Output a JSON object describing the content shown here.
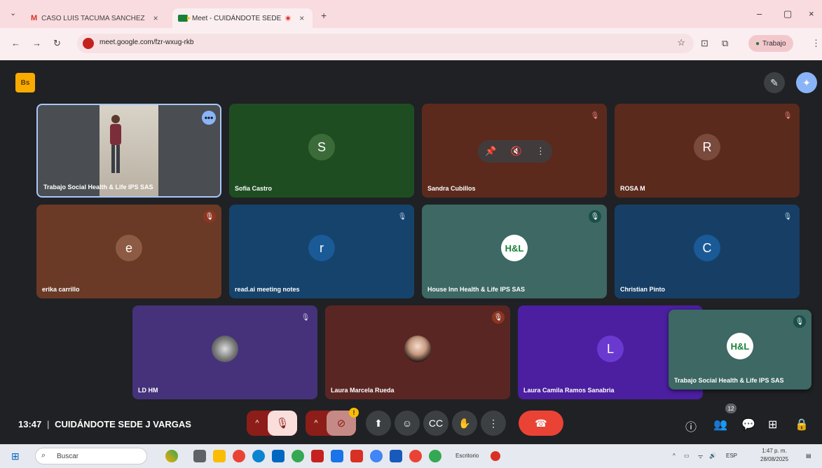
{
  "browser": {
    "tabs": [
      {
        "label": "CASO LUIS TACUMA SANCHEZ",
        "close": "×"
      },
      {
        "label": "Meet - CUIDÁNDOTE SEDE",
        "close": "×"
      }
    ],
    "new_tab": "+",
    "window_controls": {
      "minimize": "–",
      "maximize": "▢",
      "close": "×"
    },
    "url": "meet.google.com/fzr-wxug-rkb",
    "profile_label": "Trabajo"
  },
  "meet": {
    "brand_badge": "Bs",
    "tiles": [
      {
        "name": "Trabajo Social Health & Life IPS SAS",
        "type": "camera"
      },
      {
        "name": "Sofia Castro",
        "initial": "S"
      },
      {
        "name": "Sandra Cubillos",
        "initial": ""
      },
      {
        "name": "ROSA M",
        "initial": "R"
      },
      {
        "name": "erika carrillo",
        "initial": "e"
      },
      {
        "name": "read.ai meeting notes",
        "initial": "r"
      },
      {
        "name": "House Inn Health & Life IPS SAS",
        "initial": "H&L"
      },
      {
        "name": "Christian Pinto",
        "initial": "C"
      },
      {
        "name": "LD HM",
        "initial": ""
      },
      {
        "name": "Laura Marcela Rueda",
        "initial": ""
      },
      {
        "name": "Laura Camila Ramos Sanabria",
        "initial": "L"
      },
      {
        "name": "Trabajo Social Health & Life IPS SAS",
        "initial": "H&L"
      }
    ],
    "hover_icons": [
      "pin",
      "mute",
      "more"
    ],
    "time": "13:47",
    "separator": "|",
    "meeting_name": "CUIDÁNDOTE SEDE J VARGAS",
    "warning_badge": "!",
    "participant_count": "12"
  },
  "taskbar": {
    "search_label": "Buscar",
    "desktop_label": "Escritorio",
    "tray_lang": "ESP",
    "clock_time": "1:47 p. m.",
    "clock_date": "28/08/2025"
  },
  "colors": {
    "tab_strip": "#f9dcdf",
    "meet_bg": "#202124",
    "end_call": "#ea4335",
    "mic_off": "#8c1d18"
  }
}
